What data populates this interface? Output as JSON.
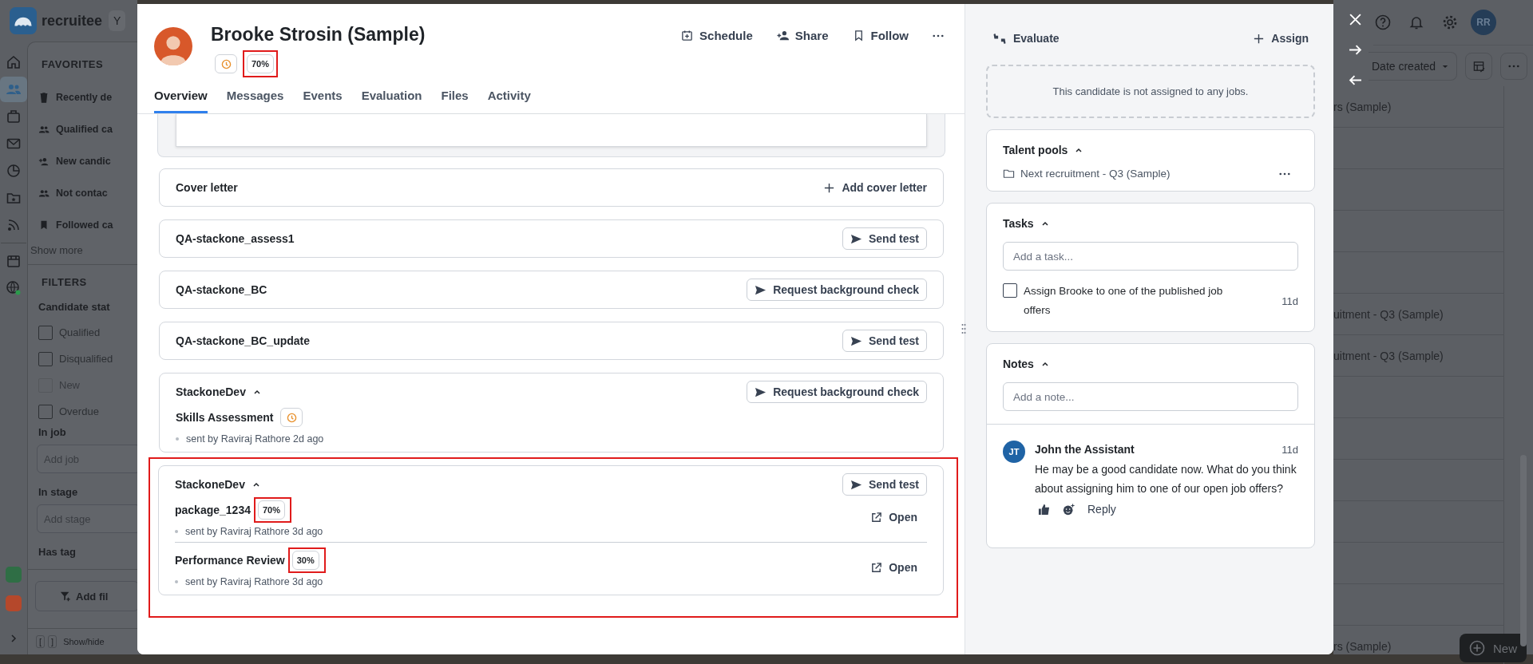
{
  "background_app": {
    "logo": "recruitee",
    "workspace": "Y",
    "rail": [
      {
        "kind": "home",
        "selected": false
      },
      {
        "kind": "people",
        "selected": true
      },
      {
        "kind": "briefcase",
        "selected": false
      },
      {
        "kind": "mail",
        "selected": false
      },
      {
        "kind": "chart",
        "selected": false
      },
      {
        "kind": "folder",
        "selected": false
      },
      {
        "kind": "feed",
        "selected": false
      },
      {
        "kind": "store",
        "selected": false
      },
      {
        "kind": "globe",
        "selected": false
      }
    ],
    "rail_apps": [
      {
        "color": "#2f6e45"
      },
      {
        "color": "#b5482b"
      }
    ],
    "favorites": {
      "title": "FAVORITES",
      "items": [
        {
          "kind": "trash",
          "label": "Recently de"
        },
        {
          "kind": "people",
          "label": "Qualified ca"
        },
        {
          "kind": "person-add",
          "label": "New candic"
        },
        {
          "kind": "people",
          "label": "Not contac"
        },
        {
          "kind": "bookmark",
          "label": "Followed ca"
        }
      ],
      "show_more": "Show more"
    },
    "filters": {
      "title": "FILTERS",
      "status_label": "Candidate stat",
      "statuses": [
        {
          "label": "Qualified",
          "checked": false,
          "disabled": false
        },
        {
          "label": "Disqualified",
          "checked": false,
          "disabled": false
        },
        {
          "label": "New",
          "checked": false,
          "disabled": true
        },
        {
          "label": "Overdue",
          "checked": false,
          "disabled": false
        }
      ],
      "fields": [
        {
          "label": "In job",
          "placeholder": "Add job"
        },
        {
          "label": "In stage",
          "placeholder": "Add stage"
        }
      ],
      "tag_label": "Has tag",
      "add_filter": "Add fil"
    },
    "footer": {
      "keys": [
        "[",
        "]"
      ],
      "label": "Show/hide"
    },
    "avatar": "RR",
    "sort": "Date created",
    "rows": [
      {
        "text": "rs (Sample)"
      },
      {},
      {},
      {},
      {},
      {
        "text": "uitment - Q3 (Sample)"
      },
      {
        "text": "uitment - Q3 (Sample)"
      },
      {},
      {},
      {},
      {},
      {},
      {},
      {
        "text": "rs (Sample)"
      }
    ],
    "new_button": "New"
  },
  "candidate": {
    "name": "Brooke Strosin (Sample)",
    "badges": [
      {
        "kind": "pending",
        "highlighted": false
      },
      {
        "kind": "score",
        "label": "70%",
        "highlighted": true
      }
    ],
    "actions": [
      {
        "kind": "calendar",
        "label": "Schedule"
      },
      {
        "kind": "share",
        "label": "Share"
      },
      {
        "kind": "bookmark",
        "label": "Follow"
      },
      {
        "kind": "more"
      }
    ],
    "tabs": [
      {
        "label": "Overview",
        "selected": true
      },
      {
        "label": "Messages",
        "selected": false
      },
      {
        "label": "Events",
        "selected": false
      },
      {
        "label": "Evaluation",
        "selected": false
      },
      {
        "label": "Files",
        "selected": false
      },
      {
        "label": "Activity",
        "selected": false
      }
    ]
  },
  "sections": [
    {
      "title": "Cover letter",
      "action": {
        "kind": "add",
        "label": "Add cover letter"
      }
    },
    {
      "title": "QA-stackone_assess1",
      "action": {
        "kind": "send",
        "label": "Send test"
      }
    },
    {
      "title": "QA-stackone_BC",
      "action": {
        "kind": "send",
        "label": "Request background check"
      }
    },
    {
      "title": "QA-stackone_BC_update",
      "action": {
        "kind": "send",
        "label": "Send test"
      }
    },
    {
      "title": "StackoneDev",
      "expanded": true,
      "highlighted": false,
      "action": {
        "kind": "send",
        "label": "Request background check"
      },
      "items": [
        {
          "name": "Skills Assessment",
          "badge": {
            "kind": "pending",
            "highlighted": false
          },
          "meta": "sent by Raviraj Rathore 2d ago"
        }
      ]
    },
    {
      "title": "StackoneDev",
      "expanded": true,
      "highlighted": true,
      "action": {
        "kind": "send",
        "label": "Send test"
      },
      "items": [
        {
          "name": "package_1234",
          "badge": {
            "kind": "score",
            "label": "70%",
            "highlighted": true
          },
          "meta": "sent by Raviraj Rathore 3d ago",
          "open": "Open"
        },
        {
          "name": "Performance Review",
          "badge": {
            "kind": "score",
            "label": "30%",
            "highlighted": true
          },
          "meta": "sent by Raviraj Rathore 3d ago",
          "open": "Open"
        }
      ]
    }
  ],
  "side": {
    "evaluate": "Evaluate",
    "assign": "Assign",
    "jobs_empty": "This candidate is not assigned to any jobs.",
    "talent_pools": {
      "title": "Talent pools",
      "expanded": true,
      "items": [
        "Next recruitment - Q3 (Sample)"
      ]
    },
    "tasks": {
      "title": "Tasks",
      "expanded": true,
      "placeholder": "Add a task...",
      "items": [
        {
          "text": "Assign Brooke to one of the published job offers",
          "checked": false,
          "age": "11d"
        }
      ]
    },
    "notes": {
      "title": "Notes",
      "expanded": true,
      "placeholder": "Add a note...",
      "items": [
        {
          "initials": "JT",
          "author": "John the Assistant",
          "age": "11d",
          "text": "He may be a good candidate now. What do you think about assigning him to one of our open job offers?",
          "reply": "Reply"
        }
      ]
    }
  }
}
